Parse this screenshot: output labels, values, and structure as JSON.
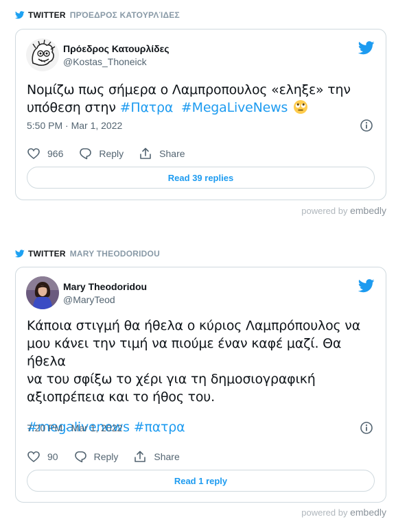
{
  "embeds": [
    {
      "source_label": "TWITTER",
      "source_author": "ΠΡΌΕΔΡΟΣ ΚΑΤΟΥΡΛΊΔΕΣ",
      "display_name": "Πρόεδρος Κατουρλίδες",
      "handle": "@Kostas_Thoneick",
      "text_plain": "Νομίζω πως σήμερα ο Λαμπροπουλος «εληξε» την υπόθεση στην ",
      "hashtags": [
        "#Πατρα",
        "#MegaLiveNews"
      ],
      "timestamp": "5:50 PM · Mar 1, 2022",
      "likes": "966",
      "reply_label": "Reply",
      "share_label": "Share",
      "read_replies": "Read 39 replies",
      "powered_by": "powered by",
      "brand": "embedly"
    },
    {
      "source_label": "TWITTER",
      "source_author": "MARY THEODORIDOU",
      "display_name": "Mary Theodoridou",
      "handle": "@MaryTeod",
      "text_line1": "Κάποια στιγμή θα ήθελα ο κύριος Λαμπρόπουλος να",
      "text_line2": "μου κάνει την τιμή να πιούμε έναν καφέ μαζί. Θα ήθελα",
      "text_line3": "να του σφίξω το χέρι για τη δημοσιογραφική",
      "text_line4": "αξιοπρέπεια και το ήθος του.",
      "hashtags": [
        "#megalivenews",
        "#πατρα"
      ],
      "timestamp": "7:20 PM · Mar 1, 2022",
      "likes": "90",
      "reply_label": "Reply",
      "share_label": "Share",
      "read_replies": "Read 1 reply",
      "powered_by": "powered by",
      "brand": "embedly"
    }
  ],
  "colors": {
    "link": "#1d9bf0",
    "border": "#cfd9de",
    "secondary_text": "#536471"
  },
  "icons": [
    "twitter-bird-icon",
    "info-icon",
    "heart-icon",
    "reply-icon",
    "share-icon",
    "rolling-eyes-emoji"
  ]
}
